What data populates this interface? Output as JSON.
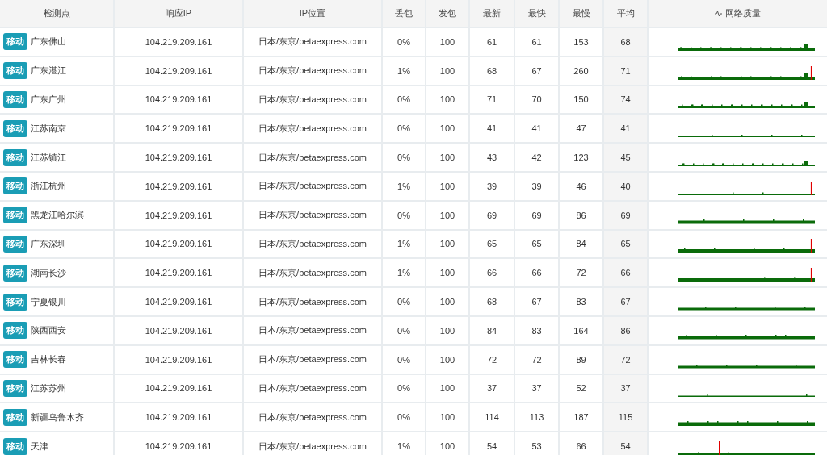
{
  "table": {
    "columns": [
      "检测点",
      "响应IP",
      "IP位置",
      "丢包",
      "发包",
      "最新",
      "最快",
      "最慢",
      "平均",
      "网络质量"
    ],
    "rows": [
      {
        "isp": "移动",
        "location": "广东佛山",
        "ip": "104.219.209.161",
        "geo": "日本/东京/petaexpress.com",
        "loss": "0%",
        "sent": "100",
        "last": "61",
        "best": "61",
        "worst": "153",
        "avg": "68"
      },
      {
        "isp": "移动",
        "location": "广东湛江",
        "ip": "104.219.209.161",
        "geo": "日本/东京/petaexpress.com",
        "loss": "1%",
        "sent": "100",
        "last": "68",
        "best": "67",
        "worst": "260",
        "avg": "71"
      },
      {
        "isp": "移动",
        "location": "广东广州",
        "ip": "104.219.209.161",
        "geo": "日本/东京/petaexpress.com",
        "loss": "0%",
        "sent": "100",
        "last": "71",
        "best": "70",
        "worst": "150",
        "avg": "74"
      },
      {
        "isp": "移动",
        "location": "江苏南京",
        "ip": "104.219.209.161",
        "geo": "日本/东京/petaexpress.com",
        "loss": "0%",
        "sent": "100",
        "last": "41",
        "best": "41",
        "worst": "47",
        "avg": "41"
      },
      {
        "isp": "移动",
        "location": "江苏镇江",
        "ip": "104.219.209.161",
        "geo": "日本/东京/petaexpress.com",
        "loss": "0%",
        "sent": "100",
        "last": "43",
        "best": "42",
        "worst": "123",
        "avg": "45"
      },
      {
        "isp": "移动",
        "location": "浙江杭州",
        "ip": "104.219.209.161",
        "geo": "日本/东京/petaexpress.com",
        "loss": "1%",
        "sent": "100",
        "last": "39",
        "best": "39",
        "worst": "46",
        "avg": "40"
      },
      {
        "isp": "移动",
        "location": "黑龙江哈尔滨",
        "ip": "104.219.209.161",
        "geo": "日本/东京/petaexpress.com",
        "loss": "0%",
        "sent": "100",
        "last": "69",
        "best": "69",
        "worst": "86",
        "avg": "69"
      },
      {
        "isp": "移动",
        "location": "广东深圳",
        "ip": "104.219.209.161",
        "geo": "日本/东京/petaexpress.com",
        "loss": "1%",
        "sent": "100",
        "last": "65",
        "best": "65",
        "worst": "84",
        "avg": "65"
      },
      {
        "isp": "移动",
        "location": "湖南长沙",
        "ip": "104.219.209.161",
        "geo": "日本/东京/petaexpress.com",
        "loss": "1%",
        "sent": "100",
        "last": "66",
        "best": "66",
        "worst": "72",
        "avg": "66"
      },
      {
        "isp": "移动",
        "location": "宁夏银川",
        "ip": "104.219.209.161",
        "geo": "日本/东京/petaexpress.com",
        "loss": "0%",
        "sent": "100",
        "last": "68",
        "best": "67",
        "worst": "83",
        "avg": "67"
      },
      {
        "isp": "移动",
        "location": "陕西西安",
        "ip": "104.219.209.161",
        "geo": "日本/东京/petaexpress.com",
        "loss": "0%",
        "sent": "100",
        "last": "84",
        "best": "83",
        "worst": "164",
        "avg": "86"
      },
      {
        "isp": "移动",
        "location": "吉林长春",
        "ip": "104.219.209.161",
        "geo": "日本/东京/petaexpress.com",
        "loss": "0%",
        "sent": "100",
        "last": "72",
        "best": "72",
        "worst": "89",
        "avg": "72"
      },
      {
        "isp": "移动",
        "location": "江苏苏州",
        "ip": "104.219.209.161",
        "geo": "日本/东京/petaexpress.com",
        "loss": "0%",
        "sent": "100",
        "last": "37",
        "best": "37",
        "worst": "52",
        "avg": "37"
      },
      {
        "isp": "移动",
        "location": "新疆乌鲁木齐",
        "ip": "104.219.209.161",
        "geo": "日本/东京/petaexpress.com",
        "loss": "0%",
        "sent": "100",
        "last": "114",
        "best": "113",
        "worst": "187",
        "avg": "115"
      },
      {
        "isp": "移动",
        "location": "天津",
        "ip": "104.219.209.161",
        "geo": "日本/东京/petaexpress.com",
        "loss": "1%",
        "sent": "100",
        "last": "54",
        "best": "53",
        "worst": "66",
        "avg": "54"
      }
    ]
  }
}
